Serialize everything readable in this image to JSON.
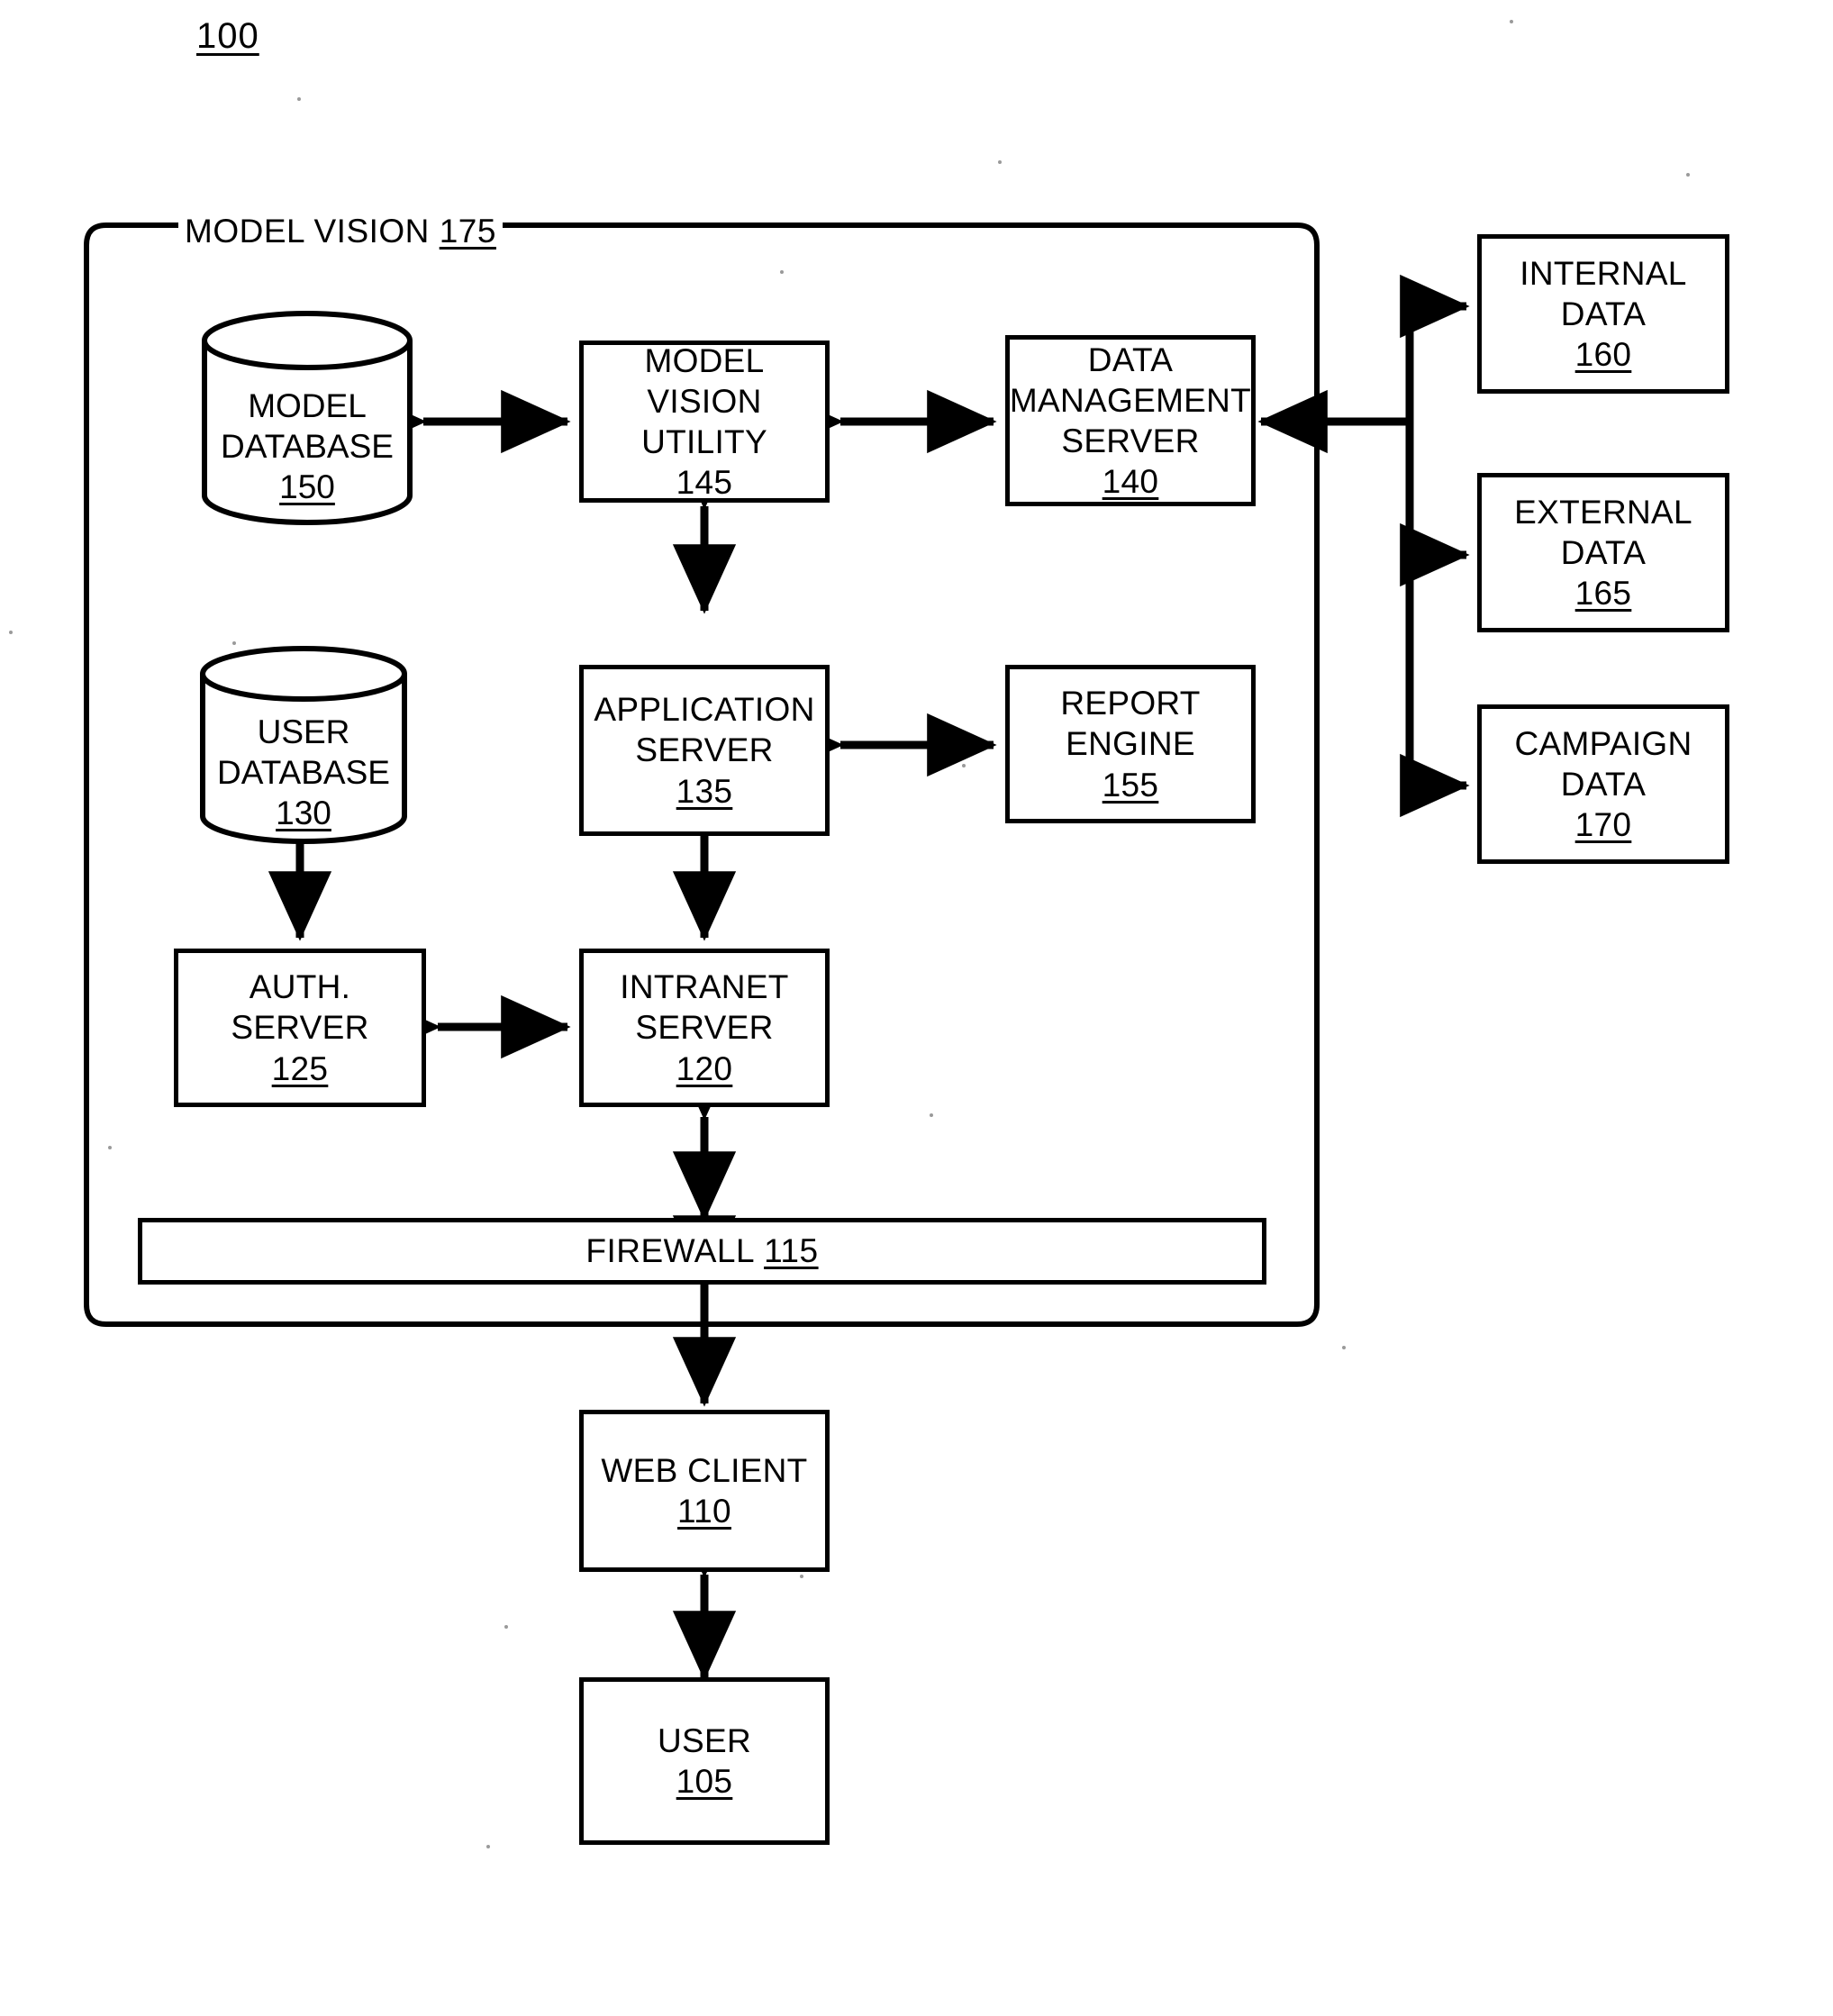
{
  "figure": {
    "number": "100",
    "boundary": {
      "label": "MODEL VISION",
      "ref": "175"
    }
  },
  "nodes": {
    "model_database": {
      "label": "MODEL\nDATABASE",
      "ref": "150",
      "shape": "cylinder"
    },
    "model_vision_utility": {
      "label": "MODEL VISION\nUTILITY",
      "ref": "145",
      "shape": "box"
    },
    "data_management_server": {
      "label": "DATA\nMANAGEMENT\nSERVER",
      "ref": "140",
      "shape": "box"
    },
    "user_database": {
      "label": "USER\nDATABASE",
      "ref": "130",
      "shape": "cylinder"
    },
    "application_server": {
      "label": "APPLICATION\nSERVER",
      "ref": "135",
      "shape": "box"
    },
    "report_engine": {
      "label": "REPORT\nENGINE",
      "ref": "155",
      "shape": "box"
    },
    "auth_server": {
      "label": "AUTH. SERVER",
      "ref": "125",
      "shape": "box"
    },
    "intranet_server": {
      "label": "INTRANET\nSERVER",
      "ref": "120",
      "shape": "box"
    },
    "firewall": {
      "label": "FIREWALL",
      "ref": "115",
      "shape": "bar"
    },
    "web_client": {
      "label": "WEB CLIENT",
      "ref": "110",
      "shape": "box"
    },
    "user": {
      "label": "USER",
      "ref": "105",
      "shape": "box"
    },
    "internal_data": {
      "label": "INTERNAL\nDATA",
      "ref": "160",
      "shape": "box"
    },
    "external_data": {
      "label": "EXTERNAL\nDATA",
      "ref": "165",
      "shape": "box"
    },
    "campaign_data": {
      "label": "CAMPAIGN\nDATA",
      "ref": "170",
      "shape": "box"
    }
  },
  "colors": {
    "ink": "#000000",
    "paper": "#ffffff"
  }
}
